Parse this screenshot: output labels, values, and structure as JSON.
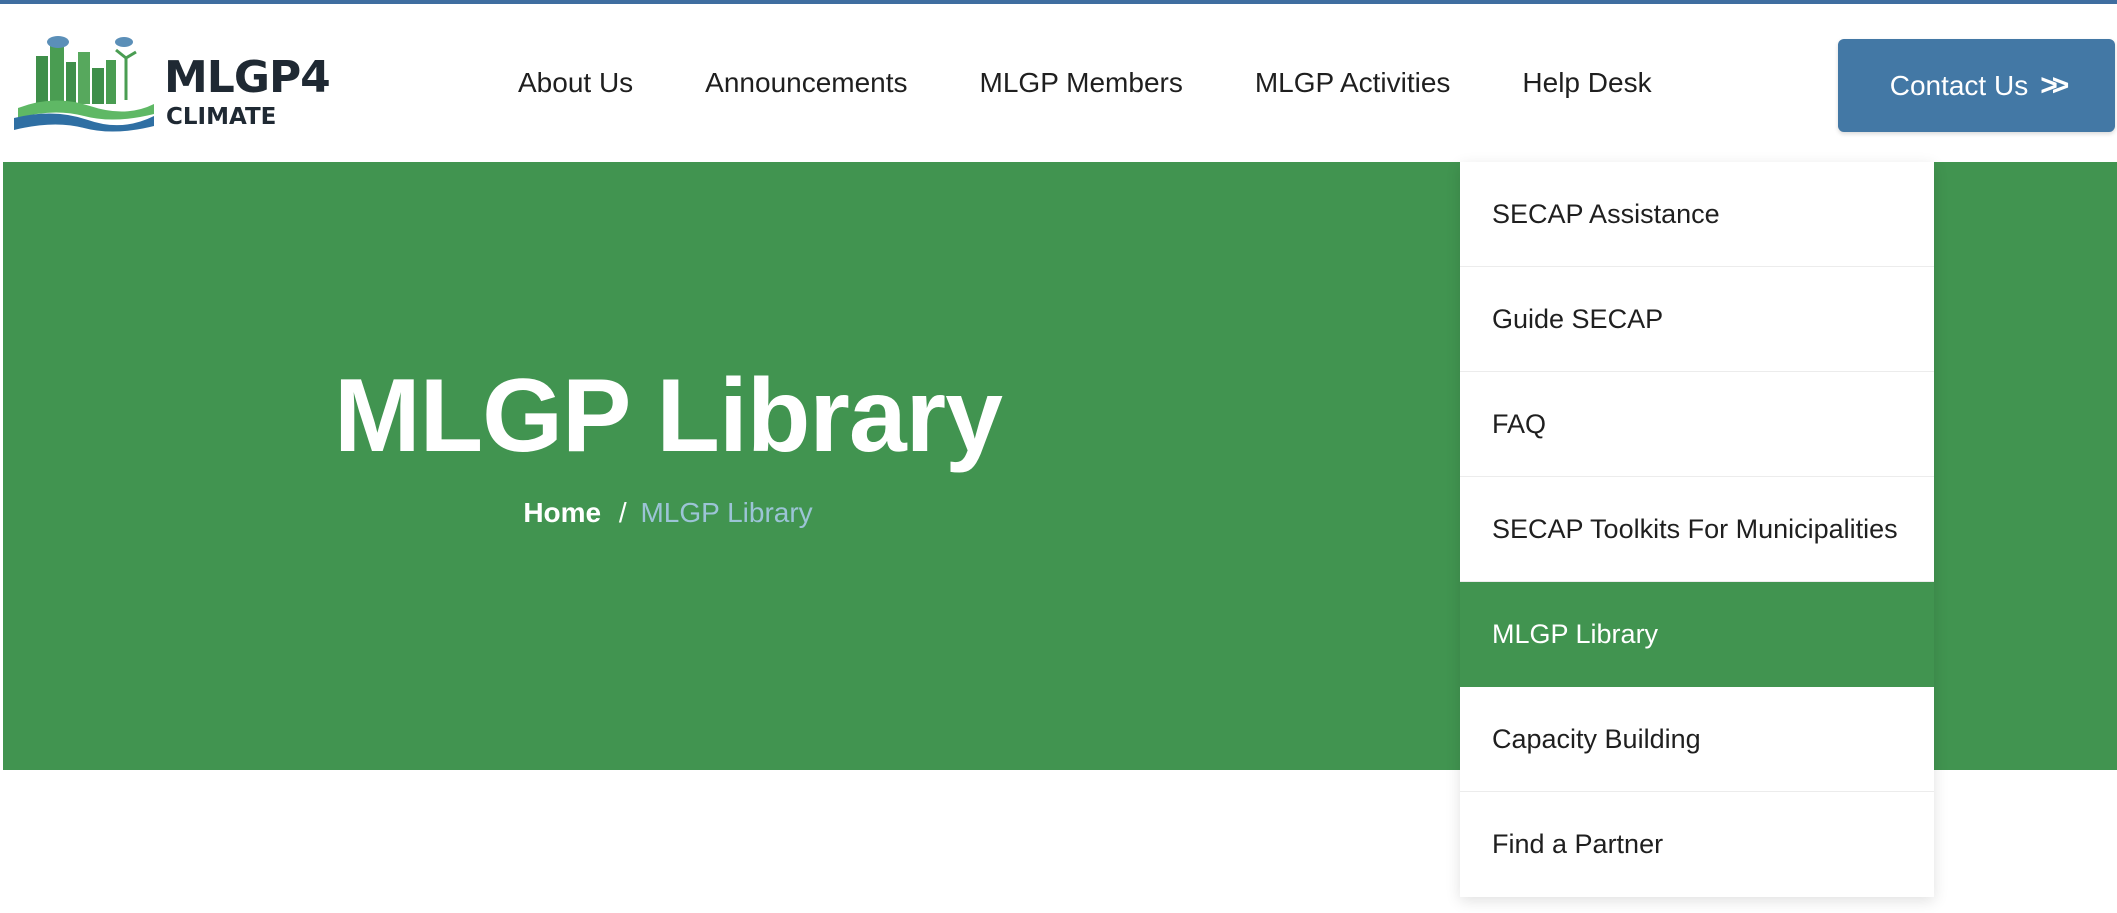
{
  "brand": {
    "name": "MLGP4",
    "subtitle": "CLIMATE"
  },
  "nav": {
    "items": [
      {
        "label": "About Us"
      },
      {
        "label": "Announcements"
      },
      {
        "label": "MLGP Members"
      },
      {
        "label": "MLGP Activities"
      },
      {
        "label": "Help Desk"
      }
    ]
  },
  "contact_button": {
    "label": "Contact Us",
    "icon": "double-chevron-right-icon"
  },
  "hero": {
    "title": "MLGP Library",
    "breadcrumb": {
      "home": "Home",
      "separator": "/",
      "current": "MLGP Library"
    }
  },
  "dropdown": {
    "items": [
      {
        "label": "SECAP Assistance",
        "active": false
      },
      {
        "label": "Guide SECAP",
        "active": false
      },
      {
        "label": "FAQ",
        "active": false
      },
      {
        "label": "SECAP Toolkits For Municipalities",
        "active": false
      },
      {
        "label": "MLGP Library",
        "active": true
      },
      {
        "label": "Capacity Building",
        "active": false
      },
      {
        "label": "Find a Partner",
        "active": false
      }
    ]
  },
  "colors": {
    "brand_green": "#419450",
    "button_blue": "#4378a5",
    "breadcrumb_current": "#9cc4d6",
    "top_line": "#3f6ea0"
  }
}
